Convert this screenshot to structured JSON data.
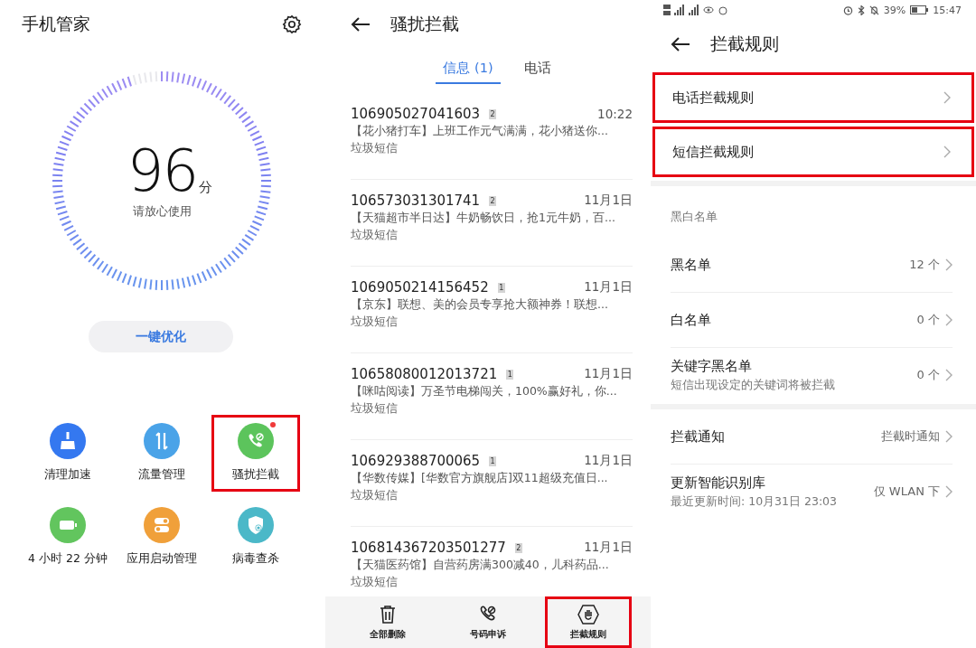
{
  "home": {
    "title": "手机管家",
    "score": {
      "value": "96",
      "unit": "分",
      "caption": "请放心使用",
      "level": 0.96
    },
    "optimize_button": "一键优化",
    "tools": [
      {
        "label": "清理加速",
        "kind": "broom",
        "color": "#3478f0",
        "badge": false,
        "highlighted": false
      },
      {
        "label": "流量管理",
        "kind": "arrows",
        "color": "#4aa3e8",
        "badge": false,
        "highlighted": false
      },
      {
        "label": "骚扰拦截",
        "kind": "phone-block",
        "color": "#5cc45c",
        "badge": true,
        "highlighted": true
      },
      {
        "label": "4 小时 22 分钟",
        "kind": "battery",
        "color": "#62c55e",
        "badge": false,
        "highlighted": false
      },
      {
        "label": "应用启动管理",
        "kind": "toggles",
        "color": "#f0a03a",
        "badge": false,
        "highlighted": false
      },
      {
        "label": "病毒查杀",
        "kind": "shield",
        "color": "#4bb8c8",
        "badge": false,
        "highlighted": false
      }
    ]
  },
  "blocking": {
    "title": "骚扰拦截",
    "tabs": [
      {
        "label": "信息 (1)",
        "selected": true
      },
      {
        "label": "电话",
        "selected": false
      }
    ],
    "messages": [
      {
        "number": "106905027041603",
        "sim": "2",
        "time": "10:22",
        "preview": "【花小猪打车】上班工作元气满满，花小猪送你...",
        "category": "垃圾短信"
      },
      {
        "number": "106573031301741",
        "sim": "2",
        "time": "11月1日",
        "preview": "【天猫超市半日达】牛奶畅饮日，抢1元牛奶，百...",
        "category": "垃圾短信"
      },
      {
        "number": "1069050214156452",
        "sim": "1",
        "time": "11月1日",
        "preview": "【京东】联想、美的会员专享抢大额神券！联想...",
        "category": "垃圾短信"
      },
      {
        "number": "10658080012013721",
        "sim": "1",
        "time": "11月1日",
        "preview": "【咪咕阅读】万圣节电梯闯关，100%赢好礼，你...",
        "category": "垃圾短信"
      },
      {
        "number": "106929388700065",
        "sim": "1",
        "time": "11月1日",
        "preview": "【华数传媒】[华数官方旗舰店]双11超级充值日...",
        "category": "垃圾短信"
      },
      {
        "number": "106814367203501277",
        "sim": "2",
        "time": "11月1日",
        "preview": "【天猫医药馆】自营药房满300减40，儿科药品...",
        "category": "垃圾短信"
      }
    ],
    "actions": [
      {
        "label": "全部删除",
        "kind": "trash",
        "highlighted": false
      },
      {
        "label": "号码申诉",
        "kind": "phone-appeal",
        "highlighted": false
      },
      {
        "label": "拦截规则",
        "kind": "hand",
        "highlighted": true
      }
    ]
  },
  "rules": {
    "status_bar": {
      "battery": "39%",
      "time": "15:47"
    },
    "title": "拦截规则",
    "rule_links": [
      {
        "label": "电话拦截规则",
        "highlighted": true
      },
      {
        "label": "短信拦截规则",
        "highlighted": true
      }
    ],
    "list_header": "黑白名单",
    "lists": [
      {
        "label": "黑名单",
        "value": "12 个"
      },
      {
        "label": "白名单",
        "value": "0 个"
      },
      {
        "label": "关键字黑名单",
        "subtitle": "短信出现设定的关键词将被拦截",
        "value": "0 个"
      }
    ],
    "settings": [
      {
        "label": "拦截通知",
        "value": "拦截时通知"
      },
      {
        "label": "更新智能识别库",
        "subtitle": "最近更新时间: 10月31日 23:03",
        "value": "仅 WLAN 下"
      }
    ]
  }
}
